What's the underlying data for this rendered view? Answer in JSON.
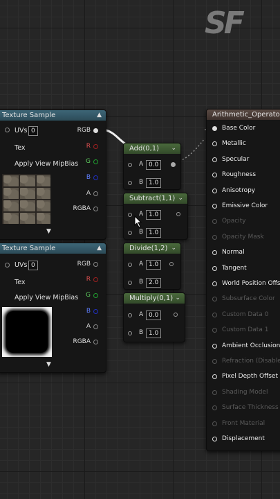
{
  "logo_text": "SF",
  "texture_sample_1": {
    "title": "Texture Sample",
    "inputs": [
      {
        "label": "UVs",
        "value": "0"
      },
      {
        "label": "Tex"
      },
      {
        "label": "Apply View MipBias"
      }
    ],
    "outputs": [
      "RGB",
      "R",
      "G",
      "B",
      "A",
      "RGBA"
    ],
    "preview": "stone-brick-texture"
  },
  "texture_sample_2": {
    "title": "Texture Sample",
    "inputs": [
      {
        "label": "UVs",
        "value": "0"
      },
      {
        "label": "Tex"
      },
      {
        "label": "Apply View MipBias"
      }
    ],
    "outputs": [
      "RGB",
      "R",
      "G",
      "B",
      "A",
      "RGBA"
    ],
    "preview": "black-mask-texture"
  },
  "math_nodes": [
    {
      "title": "Add(0,1)",
      "a": "0.0",
      "b": "1.0"
    },
    {
      "title": "Subtract(1,1)",
      "a": "1.0",
      "b": "1.0"
    },
    {
      "title": "Divide(1,2)",
      "a": "1.0",
      "b": "2.0"
    },
    {
      "title": "Multiply(0,1)",
      "a": "0.0",
      "b": "1.0"
    }
  ],
  "pin_a": "A",
  "pin_b": "B",
  "material": {
    "title": "Arithmetic_Operators",
    "pins": [
      {
        "label": "Base Color",
        "enabled": true,
        "connected": true
      },
      {
        "label": "Metallic",
        "enabled": true
      },
      {
        "label": "Specular",
        "enabled": true
      },
      {
        "label": "Roughness",
        "enabled": true
      },
      {
        "label": "Anisotropy",
        "enabled": true
      },
      {
        "label": "Emissive Color",
        "enabled": true
      },
      {
        "label": "Opacity",
        "enabled": false
      },
      {
        "label": "Opacity Mask",
        "enabled": false
      },
      {
        "label": "Normal",
        "enabled": true
      },
      {
        "label": "Tangent",
        "enabled": true
      },
      {
        "label": "World Position Offset",
        "enabled": true
      },
      {
        "label": "Subsurface Color",
        "enabled": false
      },
      {
        "label": "Custom Data 0",
        "enabled": false
      },
      {
        "label": "Custom Data 1",
        "enabled": false
      },
      {
        "label": "Ambient Occlusion",
        "enabled": true
      },
      {
        "label": "Refraction (Disabled)",
        "enabled": false
      },
      {
        "label": "Pixel Depth Offset",
        "enabled": true
      },
      {
        "label": "Shading Model",
        "enabled": false
      },
      {
        "label": "Surface Thickness",
        "enabled": false
      },
      {
        "label": "Front Material",
        "enabled": false
      },
      {
        "label": "Displacement",
        "enabled": true
      }
    ]
  },
  "colors": {
    "graph_bg": "#262626",
    "texture_header": "#3d6677",
    "math_header": "#4a6a3c",
    "material_header": "#5a4a43",
    "pin_red": "#a02020",
    "pin_green": "#20a030",
    "pin_blue": "#2030c0"
  }
}
